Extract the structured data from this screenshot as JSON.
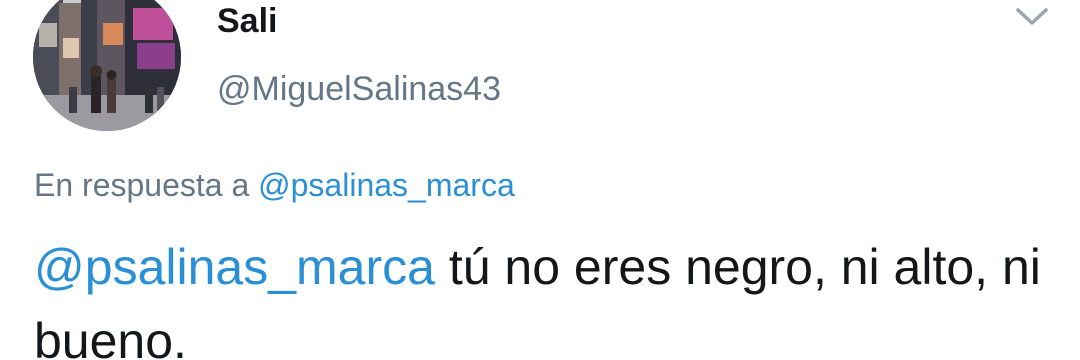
{
  "tweet": {
    "display_name": "Sali",
    "handle": "@MiguelSalinas43",
    "reply_prefix": "En respuesta a",
    "reply_to": "@psalinas_marca",
    "text_mention": "@psalinas_marca",
    "text_body": " tú no eres negro, ni alto, ni bueno."
  },
  "icons": {
    "menu": "chevron-down-icon",
    "avatar": "times-square-photo"
  },
  "colors": {
    "link": "#2b8fd6",
    "name": "#14171a",
    "secondary": "#657786"
  }
}
